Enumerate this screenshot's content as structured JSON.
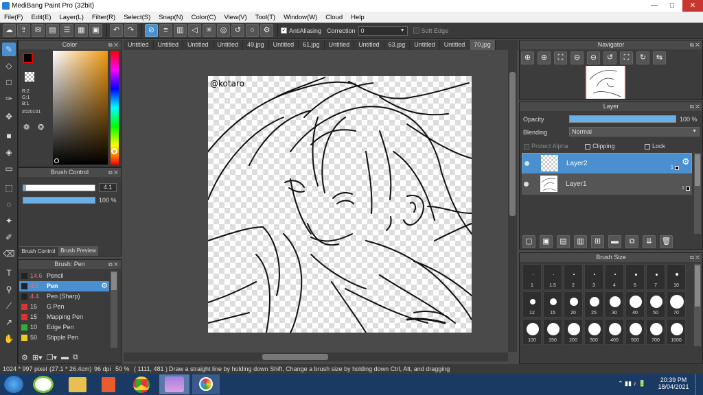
{
  "window": {
    "title": "MediBang Paint Pro (32bit)",
    "min": "—",
    "max": "□",
    "close": "✕"
  },
  "menu": [
    "File(F)",
    "Edit(E)",
    "Layer(L)",
    "Filter(R)",
    "Select(S)",
    "Snap(N)",
    "Color(C)",
    "View(V)",
    "Tool(T)",
    "Window(W)",
    "Cloud",
    "Help"
  ],
  "toolbar": {
    "antialiasing": "AntiAliasing",
    "correction_label": "Correction",
    "correction_value": "0",
    "soft_edge": "Soft Edge"
  },
  "color_panel": {
    "title": "Color",
    "r": "R:2",
    "g": "G:1",
    "b": "B:1",
    "hex": "#020101"
  },
  "brush_control": {
    "title": "Brush Control",
    "size": "4.1",
    "opacity": "100 %",
    "tab1": "Brush Control",
    "tab2": "Brush Preview"
  },
  "brush_list": {
    "title": "Brush: Pen",
    "items": [
      {
        "size": "14.6",
        "name": "Pencil",
        "color": "#222222"
      },
      {
        "size": "4.1",
        "name": "Pen",
        "color": "#222222"
      },
      {
        "size": "4.4",
        "name": "Pen (Sharp)",
        "color": "#222222"
      },
      {
        "size": "15",
        "name": "G Pen",
        "color": "#e03030"
      },
      {
        "size": "15",
        "name": "Mapping Pen",
        "color": "#e03030"
      },
      {
        "size": "10",
        "name": "Edge Pen",
        "color": "#30b030"
      },
      {
        "size": "50",
        "name": "Stipple Pen",
        "color": "#e8d020"
      }
    ]
  },
  "tabs": [
    "Untitled",
    "Untitled",
    "Untitled",
    "Untitled",
    "49.jpg",
    "Untitled",
    "61.jpg",
    "Untitled",
    "Untitled",
    "63.jpg",
    "Untitled",
    "Untitled",
    "70.jpg"
  ],
  "canvas": {
    "signature": "@kotaro"
  },
  "navigator": {
    "title": "Navigator"
  },
  "layer_panel": {
    "title": "Layer",
    "opacity_label": "Opacity",
    "opacity_value": "100 %",
    "blending_label": "Blending",
    "blending_value": "Normal",
    "protect_alpha": "Protect Alpha",
    "clipping": "Clipping",
    "lock": "Lock",
    "layers": [
      {
        "name": "Layer2",
        "num": "1"
      },
      {
        "name": "Layer1",
        "num": "1"
      }
    ]
  },
  "brush_size": {
    "title": "Brush Size",
    "sizes": [
      "1",
      "1.5",
      "2",
      "3",
      "4",
      "5",
      "7",
      "10",
      "12",
      "15",
      "20",
      "25",
      "30",
      "40",
      "50",
      "70",
      "100",
      "150",
      "200",
      "300",
      "400",
      "500",
      "700",
      "1000"
    ]
  },
  "status": {
    "dims": "1024 * 997 pixel",
    "cm": "(27.1 * 26.4cm)",
    "dpi": "96 dpi",
    "zoom": "50 %",
    "coords": "( 1111, 481 )",
    "hint": "Draw a straight line by holding down Shift, Change a brush size by holding down Ctrl, Alt, and dragging"
  },
  "taskbar": {
    "time": "20:39 PM",
    "date": "18/04/2021"
  },
  "colors": {
    "accent": "#4a8fd0",
    "panel": "#3c3c3c",
    "taskbar": "#1b3a63"
  }
}
